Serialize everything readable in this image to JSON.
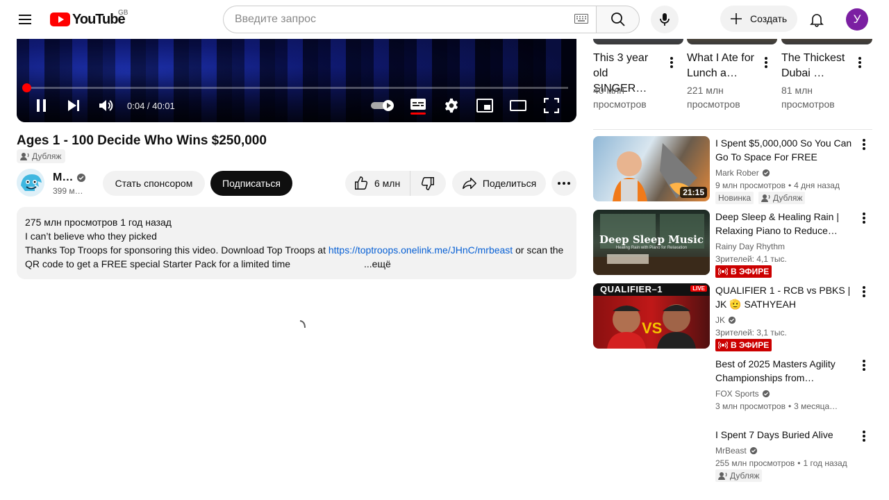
{
  "header": {
    "logo_text": "YouTube",
    "country": "GB",
    "search_placeholder": "Введите запрос",
    "create_label": "Создать",
    "avatar_letter": "У"
  },
  "player": {
    "progress_fraction": 0.0017,
    "time": "0:04 / 40:01"
  },
  "video": {
    "title": "Ages 1 - 100 Decide Who Wins $250,000",
    "dub_label": "Дубляж",
    "channel_name": "M…",
    "channel_subs": "399 м…",
    "sponsor_label": "Стать спонсором",
    "subscribe_label": "Подписаться",
    "likes": "6 млн",
    "share_label": "Поделиться"
  },
  "description": {
    "stats": "275 млн просмотров  1 год назад",
    "line1": "I can’t believe who they picked",
    "line2_prefix": "Thanks Top Troops for sponsoring this video. Download Top Troops at ",
    "link": "https://toptroops.onelink.me/JHnC/mrbeast",
    "line2_suffix": " or scan the QR code to get a FREE special Starter Pack for a limited time",
    "more": "...ещё"
  },
  "shorts": [
    {
      "title": "This 3 year old SINGER…",
      "views": "40 млн просмотров",
      "thumb_color": "#6d7a9a"
    },
    {
      "title": "What I Ate for Lunch a…",
      "views": "221 млн просмотров",
      "thumb_color": "#b5893c"
    },
    {
      "title": "The Thickest Dubai …",
      "views": "81 млн просмотров",
      "thumb_color": "#a0672c"
    }
  ],
  "recommendations": [
    {
      "title": "I Spent $5,000,000 So You Can Go To Space For FREE",
      "channel": "Mark Rober",
      "verified": true,
      "meta": "9 млн просмотров",
      "age": "4 дня назад",
      "duration": "21:15",
      "chips": [
        "Новинка",
        "Дубляж"
      ]
    },
    {
      "title": "Deep Sleep & Healing Rain | Relaxing Piano to Reduce…",
      "channel": "Rainy Day Rhythm",
      "verified": false,
      "meta": "Зрителей: 4,1 тыс.",
      "live": "В ЭФИРЕ",
      "thumb_text": "Deep Sleep Music",
      "thumb_subtext": "Healing Rain with Piano for Relaxation"
    },
    {
      "title": "QUALIFIER 1 - RCB vs PBKS | JK 🫡 SATHYEAH",
      "channel": "JK",
      "verified": true,
      "meta": "Зрителей: 3,1 тыс.",
      "live": "В ЭФИРЕ",
      "thumb_text": "QUALIFIER–1",
      "thumb_live": "LIVE"
    },
    {
      "title": "Best of 2025 Masters Agility Championships from…",
      "channel": "FOX Sports",
      "verified": true,
      "meta": "3 млн просмотров",
      "age": "3 месяца…"
    },
    {
      "title": "I Spent 7 Days Buried Alive",
      "channel": "MrBeast",
      "verified": true,
      "meta": "255 млн просмотров",
      "age": "1 год назад",
      "chips": [
        "Дубляж"
      ]
    }
  ],
  "colors": {
    "accent_red": "#ff0000",
    "live_red": "#cc0000",
    "link_blue": "#065fd4"
  }
}
